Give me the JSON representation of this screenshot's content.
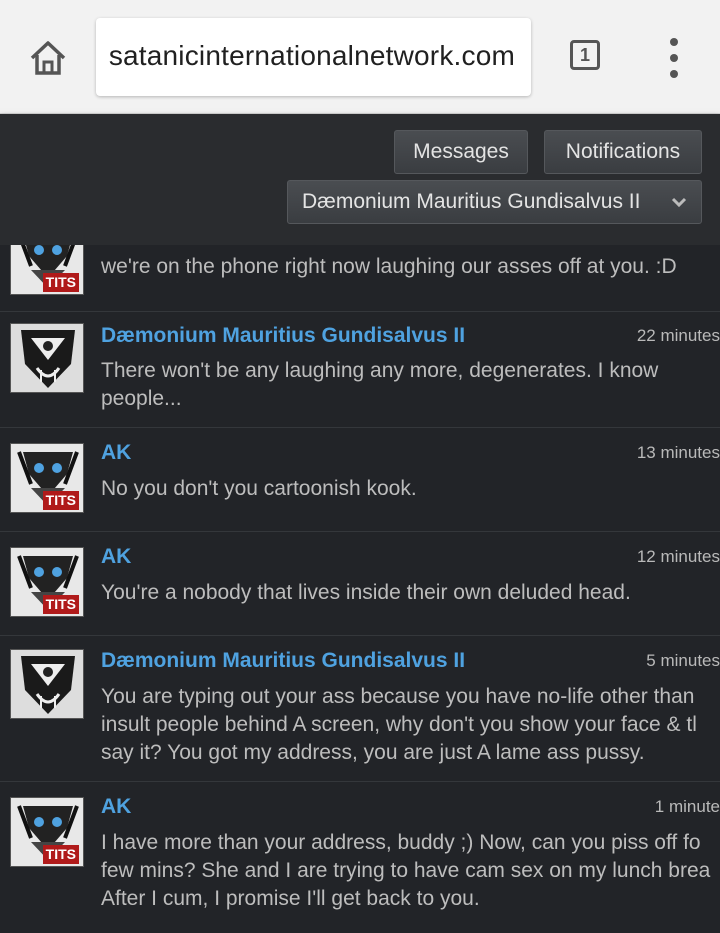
{
  "browser": {
    "url": "satanicinternationalnetwork.com",
    "tab_count": "1"
  },
  "site": {
    "messages_label": "Messages",
    "notifications_label": "Notifications",
    "user_menu_label": "Dæmonium Mauritius Gundisalvus II"
  },
  "messages": [
    {
      "author": "",
      "time": "",
      "text": "we're on the phone right now laughing our asses off at you. :D",
      "avatar": "AK",
      "badge": "TITS"
    },
    {
      "author": "Dæmonium Mauritius Gundisalvus II",
      "time": "22 minutes",
      "text": "There won't be any laughing any more, degenerates. I know\npeople...",
      "avatar": "DMG",
      "badge": ""
    },
    {
      "author": "AK",
      "time": "13 minutes",
      "text": "No you don't you cartoonish kook.",
      "avatar": "AK",
      "badge": "TITS"
    },
    {
      "author": "AK",
      "time": "12 minutes",
      "text": "You're a nobody that lives inside their own deluded head.",
      "avatar": "AK",
      "badge": "TITS"
    },
    {
      "author": "Dæmonium Mauritius Gundisalvus II",
      "time": "5 minutes",
      "text": "You are typing out your ass because you have no-life other than\ninsult people behind A screen, why don't you show your face & tl\nsay it? You got my address, you are just A lame ass pussy.",
      "avatar": "DMG",
      "badge": ""
    },
    {
      "author": "AK",
      "time": "1 minute",
      "text": "I have more than your address, buddy ;) Now, can you piss off fo\nfew mins? She and I are trying to have cam sex on my lunch brea\nAfter I cum, I promise I'll get back to you.",
      "avatar": "AK",
      "badge": "TITS"
    }
  ],
  "colors": {
    "author_link": "#4fa2e0",
    "badge": "#b01a1a",
    "background": "#222428"
  }
}
